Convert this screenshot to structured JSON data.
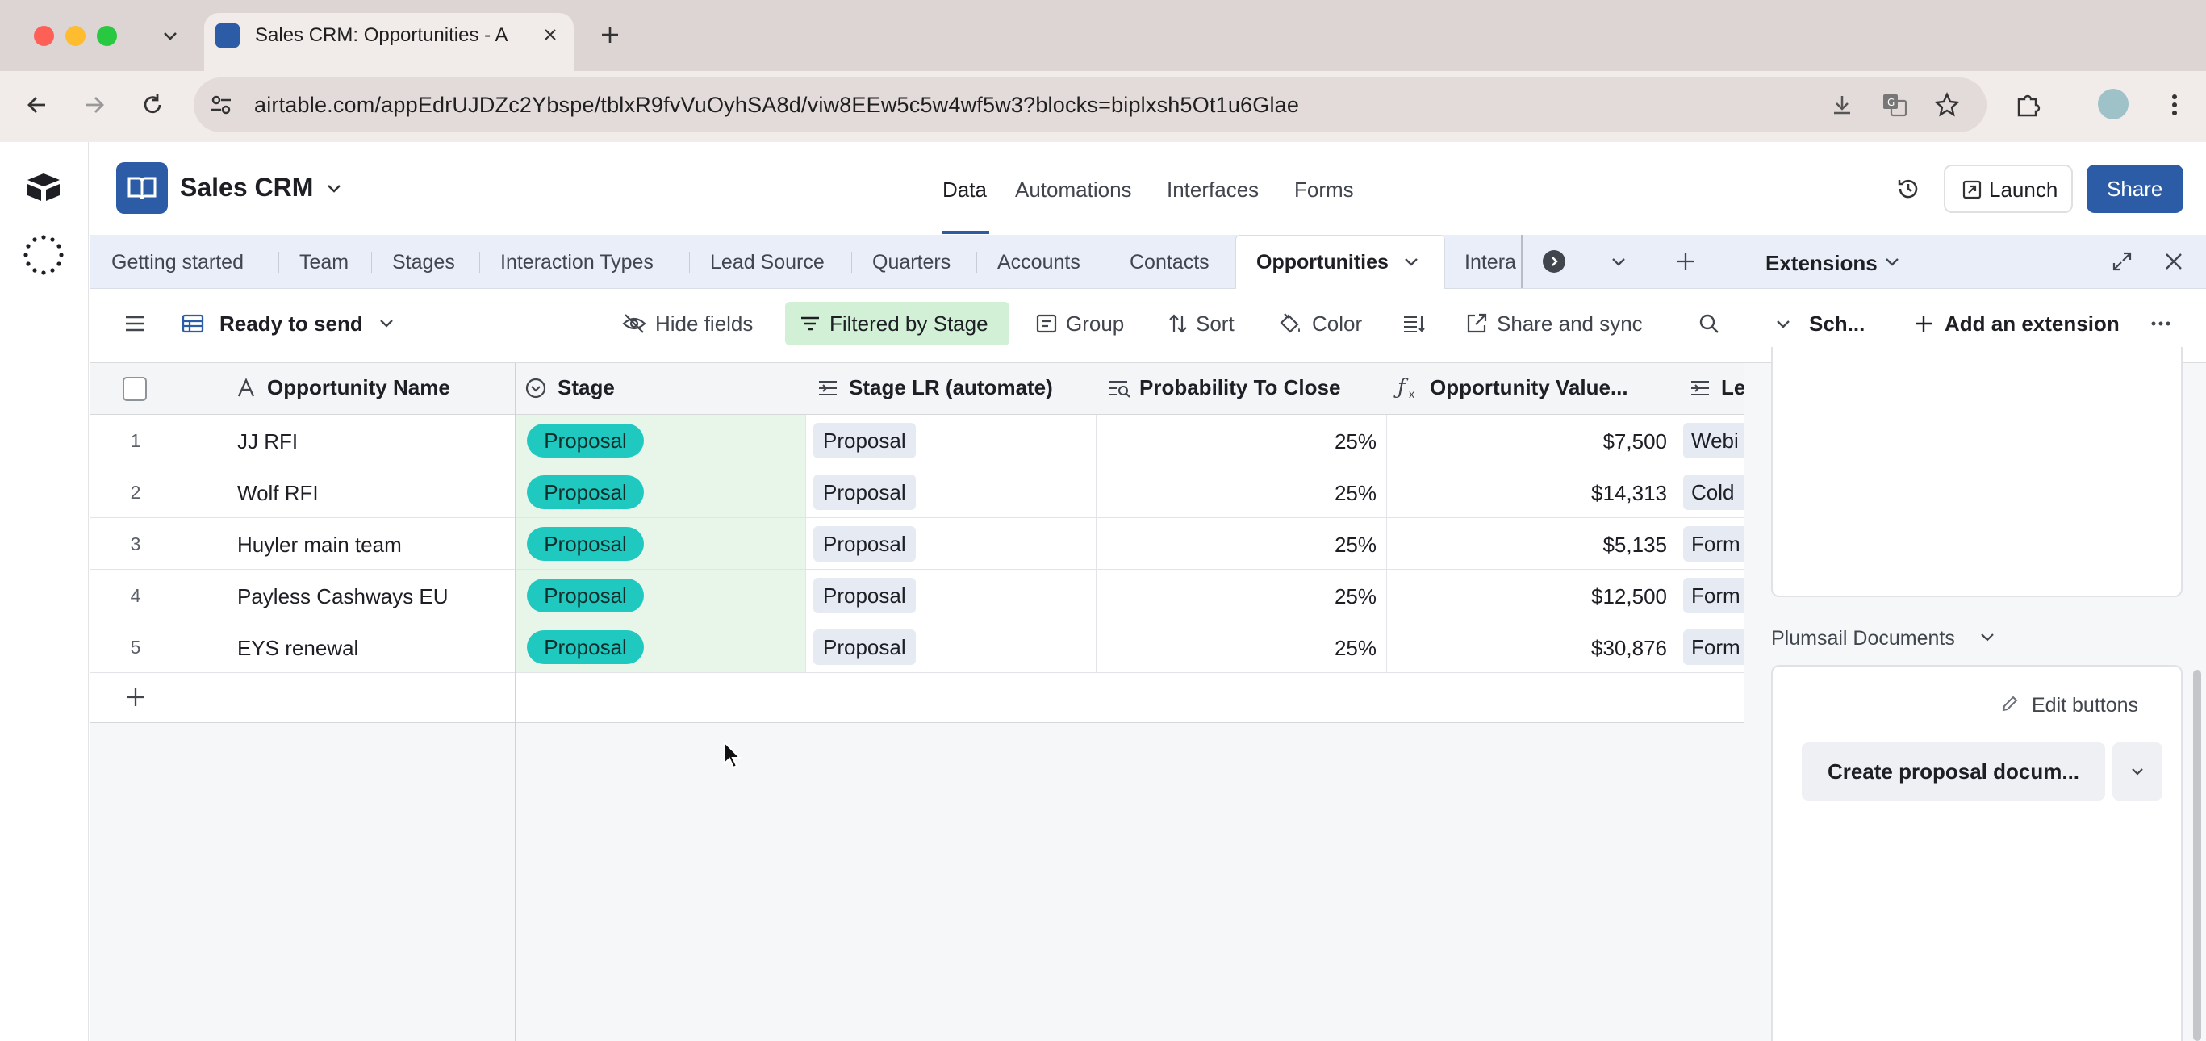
{
  "browser": {
    "tab_title": "Sales CRM: Opportunities - A",
    "url": "airtable.com/appEdrUJDZc2Ybspe/tblxR9fvVuOyhSA8d/viw8EEw5c5w4wf5w3?blocks=biplxsh5Ot1u6Glae"
  },
  "app": {
    "title": "Sales CRM",
    "nav": [
      "Data",
      "Automations",
      "Interfaces",
      "Forms"
    ],
    "launch_label": "Launch",
    "share_label": "Share"
  },
  "tables": [
    "Getting started",
    "Team",
    "Stages",
    "Interaction Types",
    "Lead Source",
    "Quarters",
    "Accounts",
    "Contacts",
    "Opportunities",
    "Intera"
  ],
  "view": {
    "name": "Ready to send",
    "hide_fields": "Hide fields",
    "filter": "Filtered by Stage",
    "group": "Group",
    "sort": "Sort",
    "color": "Color",
    "share_sync": "Share and sync"
  },
  "grid": {
    "columns": [
      "Opportunity Name",
      "Stage",
      "Stage LR (automate)",
      "Probability To Close",
      "Opportunity Value...",
      "Le"
    ],
    "rows": [
      {
        "n": "1",
        "name": "JJ RFI",
        "stage": "Proposal",
        "stage_lr": "Proposal",
        "prob": "25%",
        "value": "$7,500",
        "src": "Webi"
      },
      {
        "n": "2",
        "name": "Wolf RFI",
        "stage": "Proposal",
        "stage_lr": "Proposal",
        "prob": "25%",
        "value": "$14,313",
        "src": "Cold"
      },
      {
        "n": "3",
        "name": "Huyler main team",
        "stage": "Proposal",
        "stage_lr": "Proposal",
        "prob": "25%",
        "value": "$5,135",
        "src": "Form"
      },
      {
        "n": "4",
        "name": "Payless Cashways EU",
        "stage": "Proposal",
        "stage_lr": "Proposal",
        "prob": "25%",
        "value": "$12,500",
        "src": "Form"
      },
      {
        "n": "5",
        "name": "EYS renewal",
        "stage": "Proposal",
        "stage_lr": "Proposal",
        "prob": "25%",
        "value": "$30,876",
        "src": "Form"
      }
    ]
  },
  "extensions": {
    "title": "Extensions",
    "current": "Sch...",
    "add": "Add an extension",
    "section": "Plumsail Documents",
    "edit_buttons": "Edit buttons",
    "create": "Create proposal docum..."
  }
}
